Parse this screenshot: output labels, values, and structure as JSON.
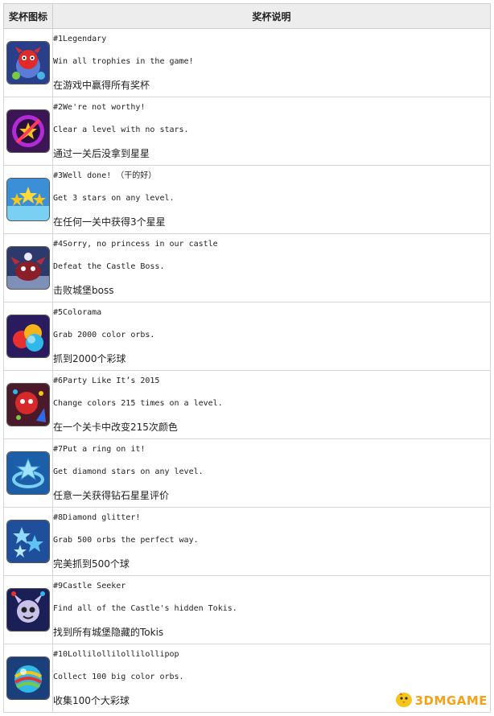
{
  "table": {
    "header_icon": "奖杯图标",
    "header_desc": "奖杯说明",
    "rows": [
      {
        "title": "#1Legendary",
        "en": "Win all trophies in the game!",
        "cn": "在游戏中赢得所有奖杯",
        "icon": "red-creature-icon"
      },
      {
        "title": "#2We're not worthy!",
        "en": "Clear a level with no stars.",
        "cn": "通过一关后没拿到星星",
        "icon": "no-star-icon"
      },
      {
        "title": "#3Well done! （干的好）",
        "en": "Get 3 stars on any level.",
        "cn": "在任何一关中获得3个星星",
        "icon": "three-stars-icon"
      },
      {
        "title": "#4Sorry, no princess in our castle",
        "en": "Defeat the Castle Boss.",
        "cn": "击败城堡boss",
        "icon": "castle-boss-icon"
      },
      {
        "title": "#5Colorama",
        "en": "Grab 2000 color orbs.",
        "cn": "抓到2000个彩球",
        "icon": "color-orbs-icon"
      },
      {
        "title": "#6Party Like It’s 2015",
        "en": "Change colors 215 times on a level.",
        "cn": "在一个关卡中改变215次颜色",
        "icon": "party-icon"
      },
      {
        "title": "#7Put a ring on it!",
        "en": "Get diamond stars on any level.",
        "cn": "任意一关获得钻石星星评价",
        "icon": "diamond-ring-icon"
      },
      {
        "title": "#8Diamond glitter!",
        "en": "Grab 500 orbs the perfect way.",
        "cn": "完美抓到500个球",
        "icon": "diamond-stars-icon"
      },
      {
        "title": "#9Castle Seeker",
        "en": "Find all of the Castle's hidden Tokis.",
        "cn": "找到所有城堡隐藏的Tokis",
        "icon": "toki-creature-icon"
      },
      {
        "title": "#10Lollilollilollilollipop",
        "en": "Collect 100 big color orbs.",
        "cn": "收集100个大彩球",
        "icon": "big-orb-icon"
      }
    ]
  },
  "watermark": {
    "text": "3DMGAME",
    "icon": "chick-mascot-icon"
  }
}
